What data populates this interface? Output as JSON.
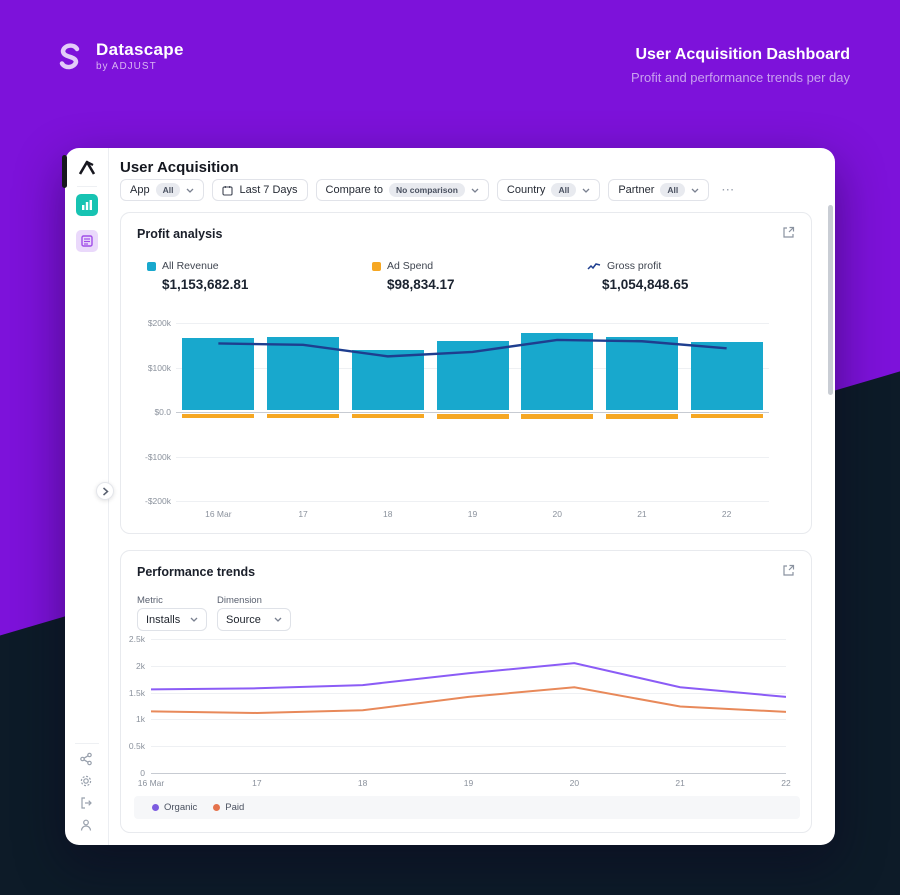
{
  "app": {
    "brand": "Datascape",
    "brand_sub": "by ADJUST",
    "title": "User Acquisition Dashboard",
    "subtitle": "Profit and performance trends per day"
  },
  "page": {
    "title": "User Acquisition"
  },
  "filters": {
    "app": {
      "label": "App",
      "value": "All"
    },
    "date": {
      "label": "Last 7 Days"
    },
    "compare": {
      "label": "Compare to",
      "value": "No comparison"
    },
    "country": {
      "label": "Country",
      "value": "All"
    },
    "partner": {
      "label": "Partner",
      "value": "All"
    },
    "more": "⋯"
  },
  "profit": {
    "title": "Profit analysis",
    "stats": [
      {
        "label": "All Revenue",
        "value": "$1,153,682.81",
        "color": "#18a8cd",
        "swatch": "square"
      },
      {
        "label": "Ad Spend",
        "value": "$98,834.17",
        "color": "#f6a723",
        "swatch": "square"
      },
      {
        "label": "Gross profit",
        "value": "$1,054,848.65",
        "color": "#1e3e8f",
        "swatch": "line"
      }
    ]
  },
  "performance": {
    "title": "Performance trends",
    "metric": {
      "label": "Metric",
      "value": "Installs"
    },
    "dimension": {
      "label": "Dimension",
      "value": "Source"
    },
    "legend": [
      {
        "label": "Organic",
        "color": "#7c5ce0"
      },
      {
        "label": "Paid",
        "color": "#e5734d"
      }
    ]
  },
  "chart_data": [
    {
      "type": "bar",
      "title": "Profit analysis",
      "categories": [
        "16 Mar",
        "17",
        "18",
        "19",
        "20",
        "21",
        "22"
      ],
      "series": [
        {
          "name": "All Revenue",
          "render": "bar",
          "color": "#18a8cd",
          "values": [
            166000,
            168000,
            140000,
            160000,
            178000,
            169000,
            157000
          ]
        },
        {
          "name": "Ad Spend",
          "render": "bar",
          "color": "#f6a723",
          "values": [
            -12000,
            -12000,
            -12000,
            -13000,
            -14000,
            -13000,
            -12000
          ]
        },
        {
          "name": "Gross profit",
          "render": "line",
          "color": "#1e3e8f",
          "values": [
            154000,
            151000,
            125000,
            135000,
            162000,
            159000,
            143000
          ]
        }
      ],
      "ylim": [
        -200000,
        200000
      ],
      "yticks": [
        200000,
        100000,
        0,
        -100000,
        -200000
      ],
      "ytick_labels": [
        "$200k",
        "$100k",
        "$0.0",
        "-$100k",
        "-$200k"
      ],
      "grid": true,
      "legend_position": "top"
    },
    {
      "type": "line",
      "title": "Performance trends",
      "categories": [
        "16 Mar",
        "17",
        "18",
        "19",
        "20",
        "21",
        "22"
      ],
      "series": [
        {
          "name": "Organic",
          "color": "#8b5cf6",
          "values": [
            1560,
            1580,
            1640,
            1860,
            2050,
            1600,
            1420
          ]
        },
        {
          "name": "Paid",
          "color": "#e8895a",
          "values": [
            1150,
            1120,
            1170,
            1420,
            1600,
            1240,
            1140
          ]
        }
      ],
      "ylim": [
        0,
        2500
      ],
      "yticks": [
        2500,
        2000,
        1500,
        1000,
        500,
        0
      ],
      "ytick_labels": [
        "2.5k",
        "2k",
        "1.5k",
        "1k",
        "0.5k",
        "0"
      ],
      "grid": true,
      "legend_position": "bottom"
    }
  ]
}
